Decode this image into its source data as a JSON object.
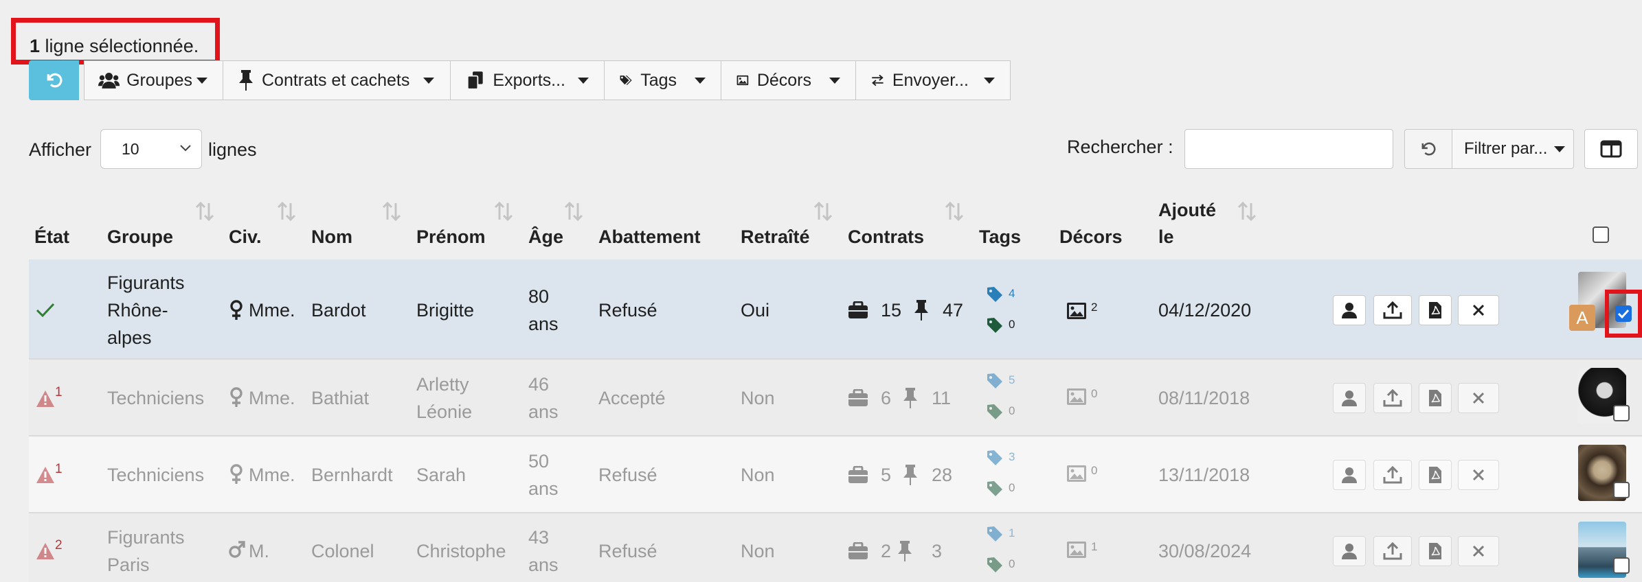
{
  "selection": {
    "count": "1",
    "text": "ligne sélectionnée."
  },
  "toolbar": {
    "buttons": [
      {
        "label": "Groupes",
        "icon": "users-icon"
      },
      {
        "label": "Contrats et cachets",
        "icon": "pin-icon"
      },
      {
        "label": "Exports...",
        "icon": "copy-icon"
      },
      {
        "label": "Tags",
        "icon": "tags-icon"
      },
      {
        "label": "Décors",
        "icon": "image-icon"
      },
      {
        "label": "Envoyer...",
        "icon": "exchange-icon"
      }
    ]
  },
  "length": {
    "prefix": "Afficher",
    "value": "10",
    "suffix": "lignes"
  },
  "search": {
    "label": "Rechercher :",
    "value": ""
  },
  "filter": {
    "label": "Filtrer par..."
  },
  "columns": [
    "État",
    "Groupe",
    "Civ.",
    "Nom",
    "Prénom",
    "Âge",
    "Abattement",
    "Retraîté",
    "Contrats",
    "Tags",
    "Décors",
    "Ajouté",
    "le"
  ],
  "rows": [
    {
      "state": "",
      "state_count": "",
      "group_lines": [
        "Figurants",
        "Rhône-",
        "alpes"
      ],
      "civ": "Mme.",
      "nom": "Bardot",
      "prenom_lines": [
        "Brigitte",
        ""
      ],
      "age_lines": [
        "80",
        "ans"
      ],
      "abattement": "Refusé",
      "retraite": "Oui",
      "contrats": "15",
      "cachets": "47",
      "tag_blue": "4",
      "tag_green": "0",
      "decors": "2",
      "date": "04/12/2020",
      "badge": "A",
      "selected": true
    },
    {
      "state": "",
      "state_count": "1",
      "group_lines": [
        "Techniciens",
        "",
        ""
      ],
      "civ": "Mme.",
      "nom": "Bathiat",
      "prenom_lines": [
        "Arletty",
        "Léonie"
      ],
      "age_lines": [
        "46",
        "ans"
      ],
      "abattement": "Accepté",
      "retraite": "Non",
      "contrats": "6",
      "cachets": "11",
      "tag_blue": "5",
      "tag_green": "0",
      "decors": "0",
      "date": "08/11/2018",
      "selected": false
    },
    {
      "state": "",
      "state_count": "1",
      "group_lines": [
        "Techniciens",
        "",
        ""
      ],
      "civ": "Mme.",
      "nom": "Bernhardt",
      "prenom_lines": [
        "Sarah",
        ""
      ],
      "age_lines": [
        "50",
        "ans"
      ],
      "abattement": "Refusé",
      "retraite": "Non",
      "contrats": "5",
      "cachets": "28",
      "tag_blue": "3",
      "tag_green": "0",
      "decors": "0",
      "date": "13/11/2018",
      "selected": false
    },
    {
      "state": "",
      "state_count": "2",
      "group_lines": [
        "Figurants",
        "Paris",
        ""
      ],
      "civ": "M.",
      "nom": "Colonel",
      "prenom_lines": [
        "Christophe",
        ""
      ],
      "age_lines": [
        "43",
        "ans"
      ],
      "abattement": "Refusé",
      "retraite": "Non",
      "contrats": "2",
      "cachets": "3",
      "tag_blue": "1",
      "tag_green": "0",
      "decors": "1",
      "date": "30/08/2024",
      "selected": false
    }
  ],
  "colors": {
    "accent": "#5bc0de",
    "selected_row": "#dce5ed",
    "highlight": "#e1141b",
    "warning": "#b8353a",
    "check": "#2e7d32"
  }
}
